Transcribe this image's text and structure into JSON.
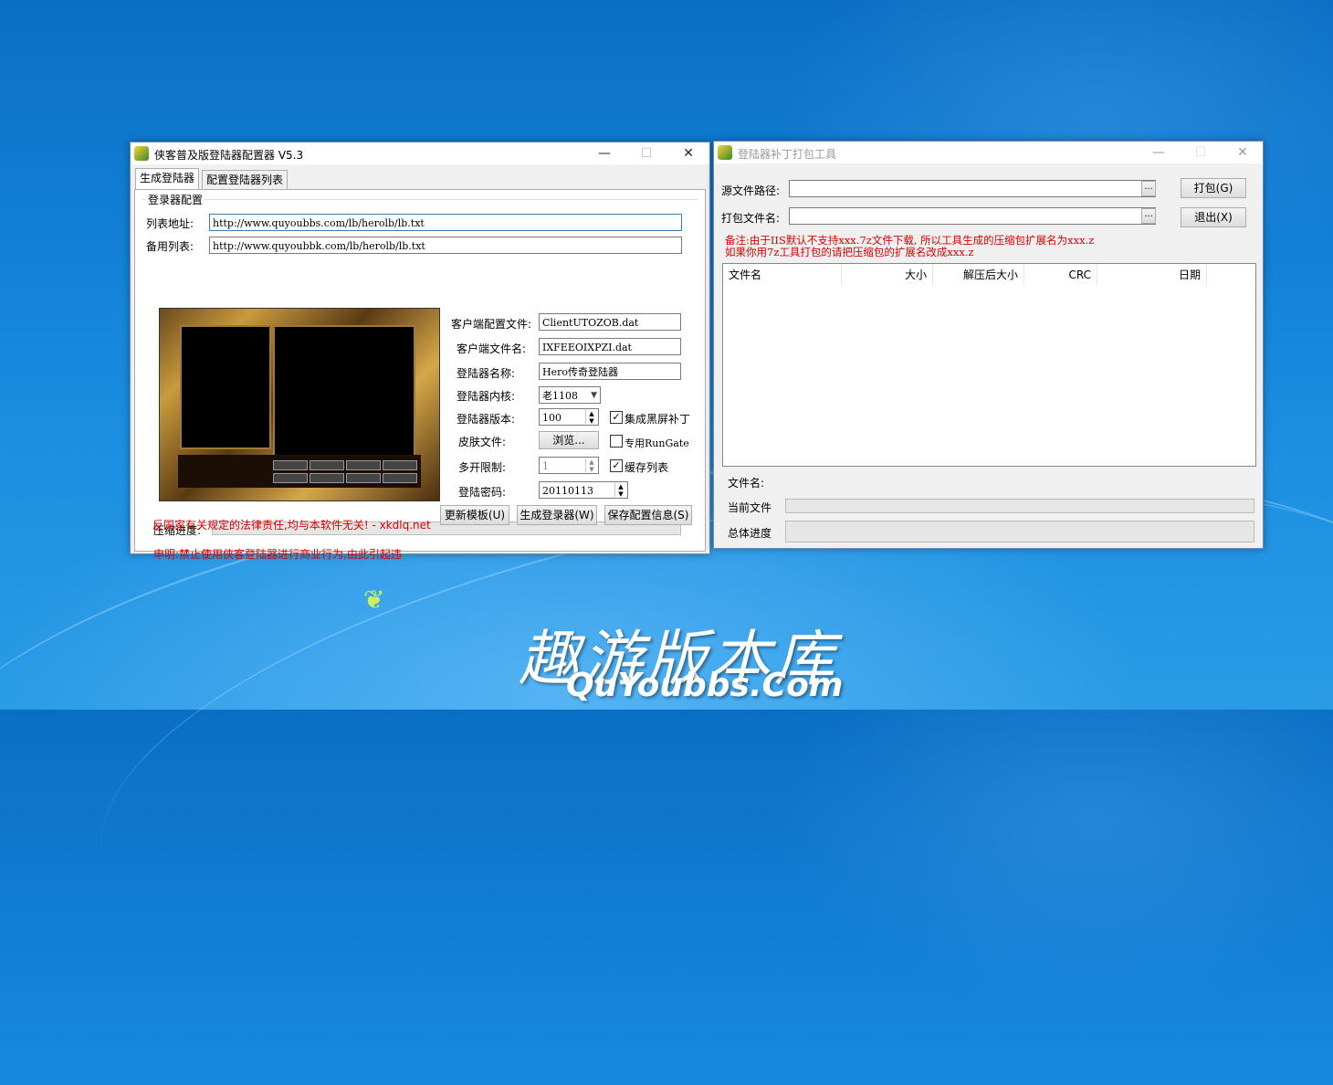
{
  "win1": {
    "title": "侠客普及版登陆器配置器 V5.3",
    "tabs": [
      "生成登陆器",
      "配置登陆器列表"
    ],
    "group_label": "登录器配置",
    "list_label": "列表地址:",
    "list_value": "http://www.quyoubbs.com/lb/herolb/lb.txt",
    "backup_label": "备用列表:",
    "backup_value": "http://www.quyoubbk.com/lb/herolb/lb.txt",
    "client_cfg_label": "客户端配置文件:",
    "client_cfg_value": "ClientUTOZOB.dat",
    "client_name_label": "客户端文件名:",
    "client_name_value": "IXFEEOIXPZI.dat",
    "launcher_name_label": "登陆器名称:",
    "launcher_name_value": "Hero传奇登陆器",
    "core_label": "登陆器内核:",
    "core_value": "老1108",
    "version_label": "登陆器版本:",
    "version_value": "100",
    "skin_label": "皮肤文件:",
    "browse_label": "浏览...",
    "multi_label": "多开限制:",
    "multi_value": "1",
    "pwd_label": "登陆密码:",
    "pwd_value": "20110113",
    "chk_black": "集成黑屏补丁",
    "chk_runGate": "专用RunGate",
    "chk_cache": "缓存列表",
    "progress_label": "压缩进度:",
    "notice1": "申明:禁止使用侠客登陆器进行商业行为,由此引起违",
    "notice2": "反国家有关规定的法律责任,均与本软件无关! - xkdlq.net",
    "btn_update": "更新模板(U)",
    "btn_generate": "生成登录器(W)",
    "btn_save": "保存配置信息(S)"
  },
  "win2": {
    "title": "登陆器补丁打包工具",
    "src_label": "源文件路径:",
    "pack_label": "打包文件名:",
    "browse": "...",
    "btn_pack": "打包(G)",
    "btn_exit": "退出(X)",
    "note1": "备注:由于IIS默认不支持xxx.7z文件下载, 所以工具生成的压缩包扩展名为xxx.z",
    "note2": "如果你用7z工具打包的请把压缩包的扩展名改成xxx.z",
    "columns": [
      "文件名",
      "大小",
      "解压后大小",
      "CRC",
      "日期"
    ],
    "filename_label": "文件名:",
    "current_label": "当前文件",
    "total_label": "总体进度"
  },
  "watermark": {
    "cn": "趣游版本库",
    "en": "QuYoubbs.Com"
  },
  "window_controls": {
    "minimize": "—",
    "maximize": "☐",
    "close": "✕"
  }
}
